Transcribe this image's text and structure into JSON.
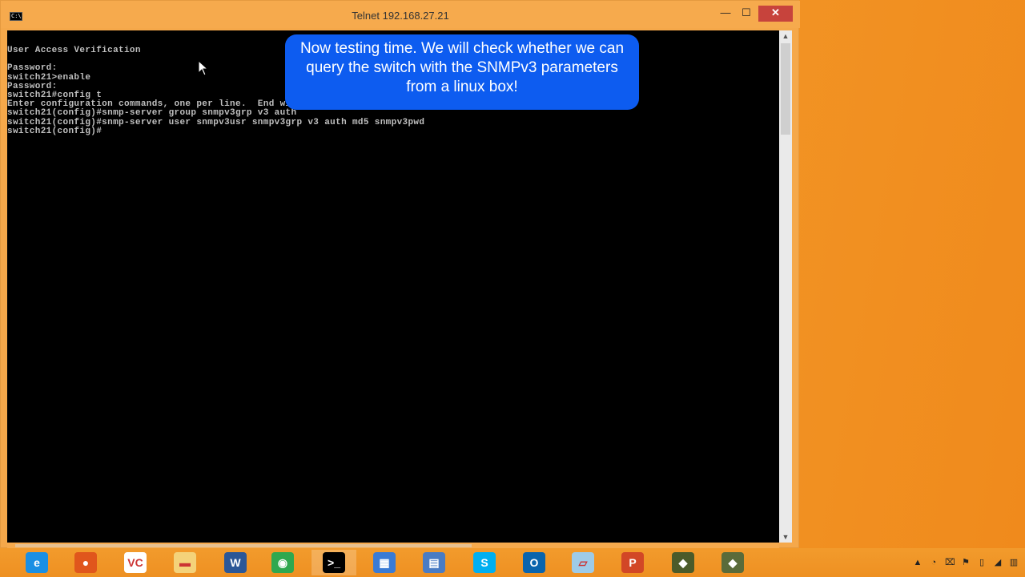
{
  "window": {
    "title": "Telnet 192.168.27.21",
    "sys_icon_text": "C:\\",
    "min_label": "—",
    "max_label": "☐",
    "close_label": "✕"
  },
  "console": {
    "text": "User Access Verification\n\nPassword:\nswitch21>enable\nPassword:\nswitch21#config t\nEnter configuration commands, one per line.  End with CNTL/Z.\nswitch21(config)#snmp-server group snmpv3grp v3 auth\nswitch21(config)#snmp-server user snmpv3usr snmpv3grp v3 auth md5 snmpv3pwd\nswitch21(config)#"
  },
  "callout": {
    "text": "Now testing time. We will check whether we can query the switch with the SNMPv3 parameters from a linux box!"
  },
  "taskbar": {
    "items": [
      {
        "name": "internet-explorer-icon",
        "glyph": "e",
        "color": "#1a8fe3"
      },
      {
        "name": "firefox-icon",
        "glyph": "●",
        "color": "#e0561c"
      },
      {
        "name": "vnc-viewer-icon",
        "glyph": "VC",
        "color": "#ffffff"
      },
      {
        "name": "file-explorer-icon",
        "glyph": "▬",
        "color": "#f4d27a"
      },
      {
        "name": "word-icon",
        "glyph": "W",
        "color": "#2b5797"
      },
      {
        "name": "chrome-icon",
        "glyph": "◉",
        "color": "#2fa84f"
      },
      {
        "name": "command-prompt-icon",
        "glyph": ">_",
        "color": "#000000"
      },
      {
        "name": "remote-desktop-icon",
        "glyph": "▦",
        "color": "#3a7bd5"
      },
      {
        "name": "network-tool-icon",
        "glyph": "▤",
        "color": "#4a7cc4"
      },
      {
        "name": "skype-icon",
        "glyph": "S",
        "color": "#00aff0"
      },
      {
        "name": "outlook-icon",
        "glyph": "O",
        "color": "#0a64ad"
      },
      {
        "name": "notepad-icon",
        "glyph": "▱",
        "color": "#9ecbe8"
      },
      {
        "name": "powerpoint-icon",
        "glyph": "P",
        "color": "#d24726"
      },
      {
        "name": "app-icon-green",
        "glyph": "◆",
        "color": "#4b5b2a"
      },
      {
        "name": "app-icon-red",
        "glyph": "◆",
        "color": "#5a6b3a"
      }
    ],
    "tray": [
      {
        "name": "show-hidden-icons-icon",
        "glyph": "▲"
      },
      {
        "name": "wifi-icon",
        "glyph": "◔"
      },
      {
        "name": "network-icon",
        "glyph": "⌧"
      },
      {
        "name": "action-center-flag-icon",
        "glyph": "⚑"
      },
      {
        "name": "power-icon",
        "glyph": "▯"
      },
      {
        "name": "volume-icon",
        "glyph": "◢"
      },
      {
        "name": "signal-icon",
        "glyph": "▥"
      }
    ]
  }
}
